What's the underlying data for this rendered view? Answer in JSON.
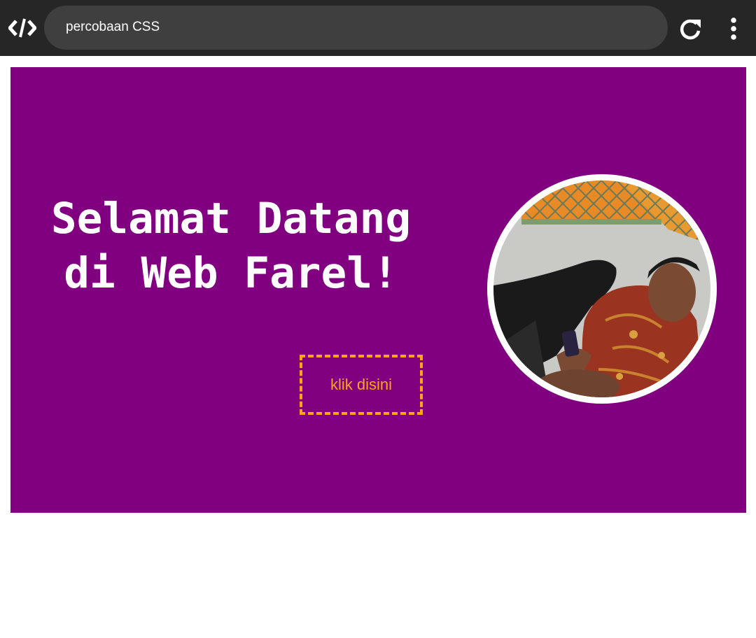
{
  "browser": {
    "url_title": "percobaan CSS",
    "icons": {
      "logo": "code-slash-icon",
      "reload": "reload-icon",
      "menu": "kebab-menu-icon"
    }
  },
  "hero": {
    "background": "#800080",
    "headline_line1": "Selamat Datang",
    "headline_di": "di",
    "headline_bold": "Web Farel!",
    "button_label": "klik disini",
    "button_color": "#ffa31a",
    "photo": "profile-photo"
  }
}
